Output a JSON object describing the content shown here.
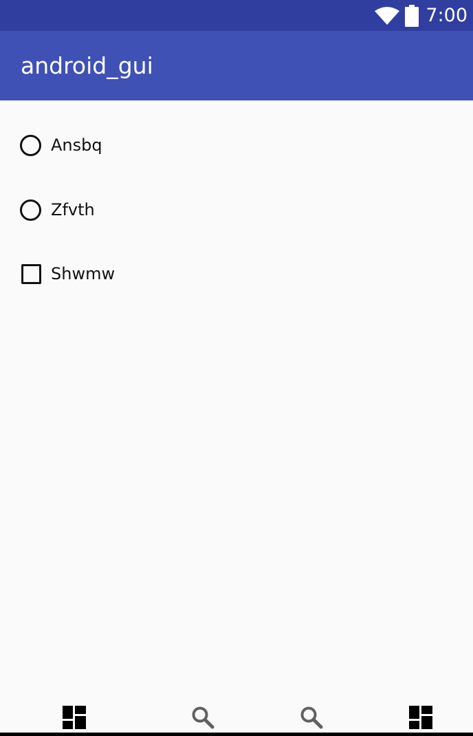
{
  "status_bar": {
    "time": "7:00",
    "icons": [
      "wifi-icon",
      "battery-icon"
    ]
  },
  "app_bar": {
    "title": "android_gui"
  },
  "options": [
    {
      "type": "radio",
      "label": "Ansbq",
      "checked": false
    },
    {
      "type": "radio",
      "label": "Zfvth",
      "checked": false
    },
    {
      "type": "checkbox",
      "label": "Shwmw",
      "checked": false
    }
  ],
  "bottom_nav": {
    "items": [
      "dashboard-icon",
      "search-icon",
      "search-icon",
      "dashboard-icon"
    ]
  },
  "colors": {
    "status_bar": "#303f9f",
    "app_bar": "#3f51b5",
    "background": "#fafafa"
  }
}
